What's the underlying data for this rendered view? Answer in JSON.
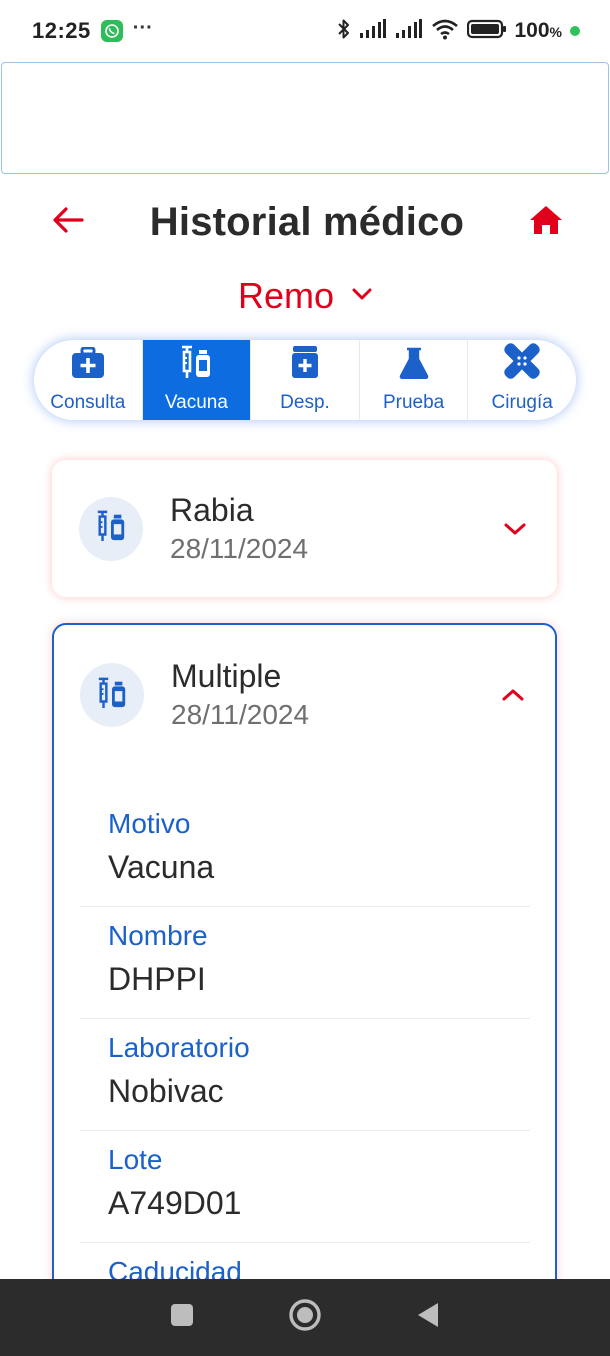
{
  "status_bar": {
    "time": "12:25",
    "dots": "···",
    "battery": "100",
    "battery_unit": "%",
    "icons": [
      "whatsapp-icon",
      "bluetooth-icon",
      "signal-icon",
      "signal-icon",
      "wifi-icon",
      "battery-icon"
    ]
  },
  "header": {
    "title": "Historial médico",
    "back_icon": "arrow-left-icon",
    "home_icon": "home-icon"
  },
  "pet": {
    "name": "Remo",
    "icon": "chevron-down-icon"
  },
  "tabs": [
    {
      "label": "Consulta",
      "icon": "medical-kit-icon",
      "active": false
    },
    {
      "label": "Vacuna",
      "icon": "syringe-vial-icon",
      "active": true
    },
    {
      "label": "Desp.",
      "icon": "medicine-jar-icon",
      "active": false
    },
    {
      "label": "Prueba",
      "icon": "flask-icon",
      "active": false
    },
    {
      "label": "Cirugía",
      "icon": "bandage-icon",
      "active": false
    }
  ],
  "records": [
    {
      "title": "Rabia",
      "date": "28/11/2024",
      "expanded": false
    },
    {
      "title": "Multiple",
      "date": "28/11/2024",
      "expanded": true,
      "details": [
        {
          "label": "Motivo",
          "value": "Vacuna"
        },
        {
          "label": "Nombre",
          "value": "DHPPI"
        },
        {
          "label": "Laboratorio",
          "value": "Nobivac"
        },
        {
          "label": "Lote",
          "value": "A749D01"
        },
        {
          "label": "Caducidad",
          "value": ""
        }
      ]
    }
  ],
  "colors": {
    "accent_blue": "#1c61c9",
    "active_tab": "#0d6de0",
    "accent_red": "#e0001b"
  }
}
